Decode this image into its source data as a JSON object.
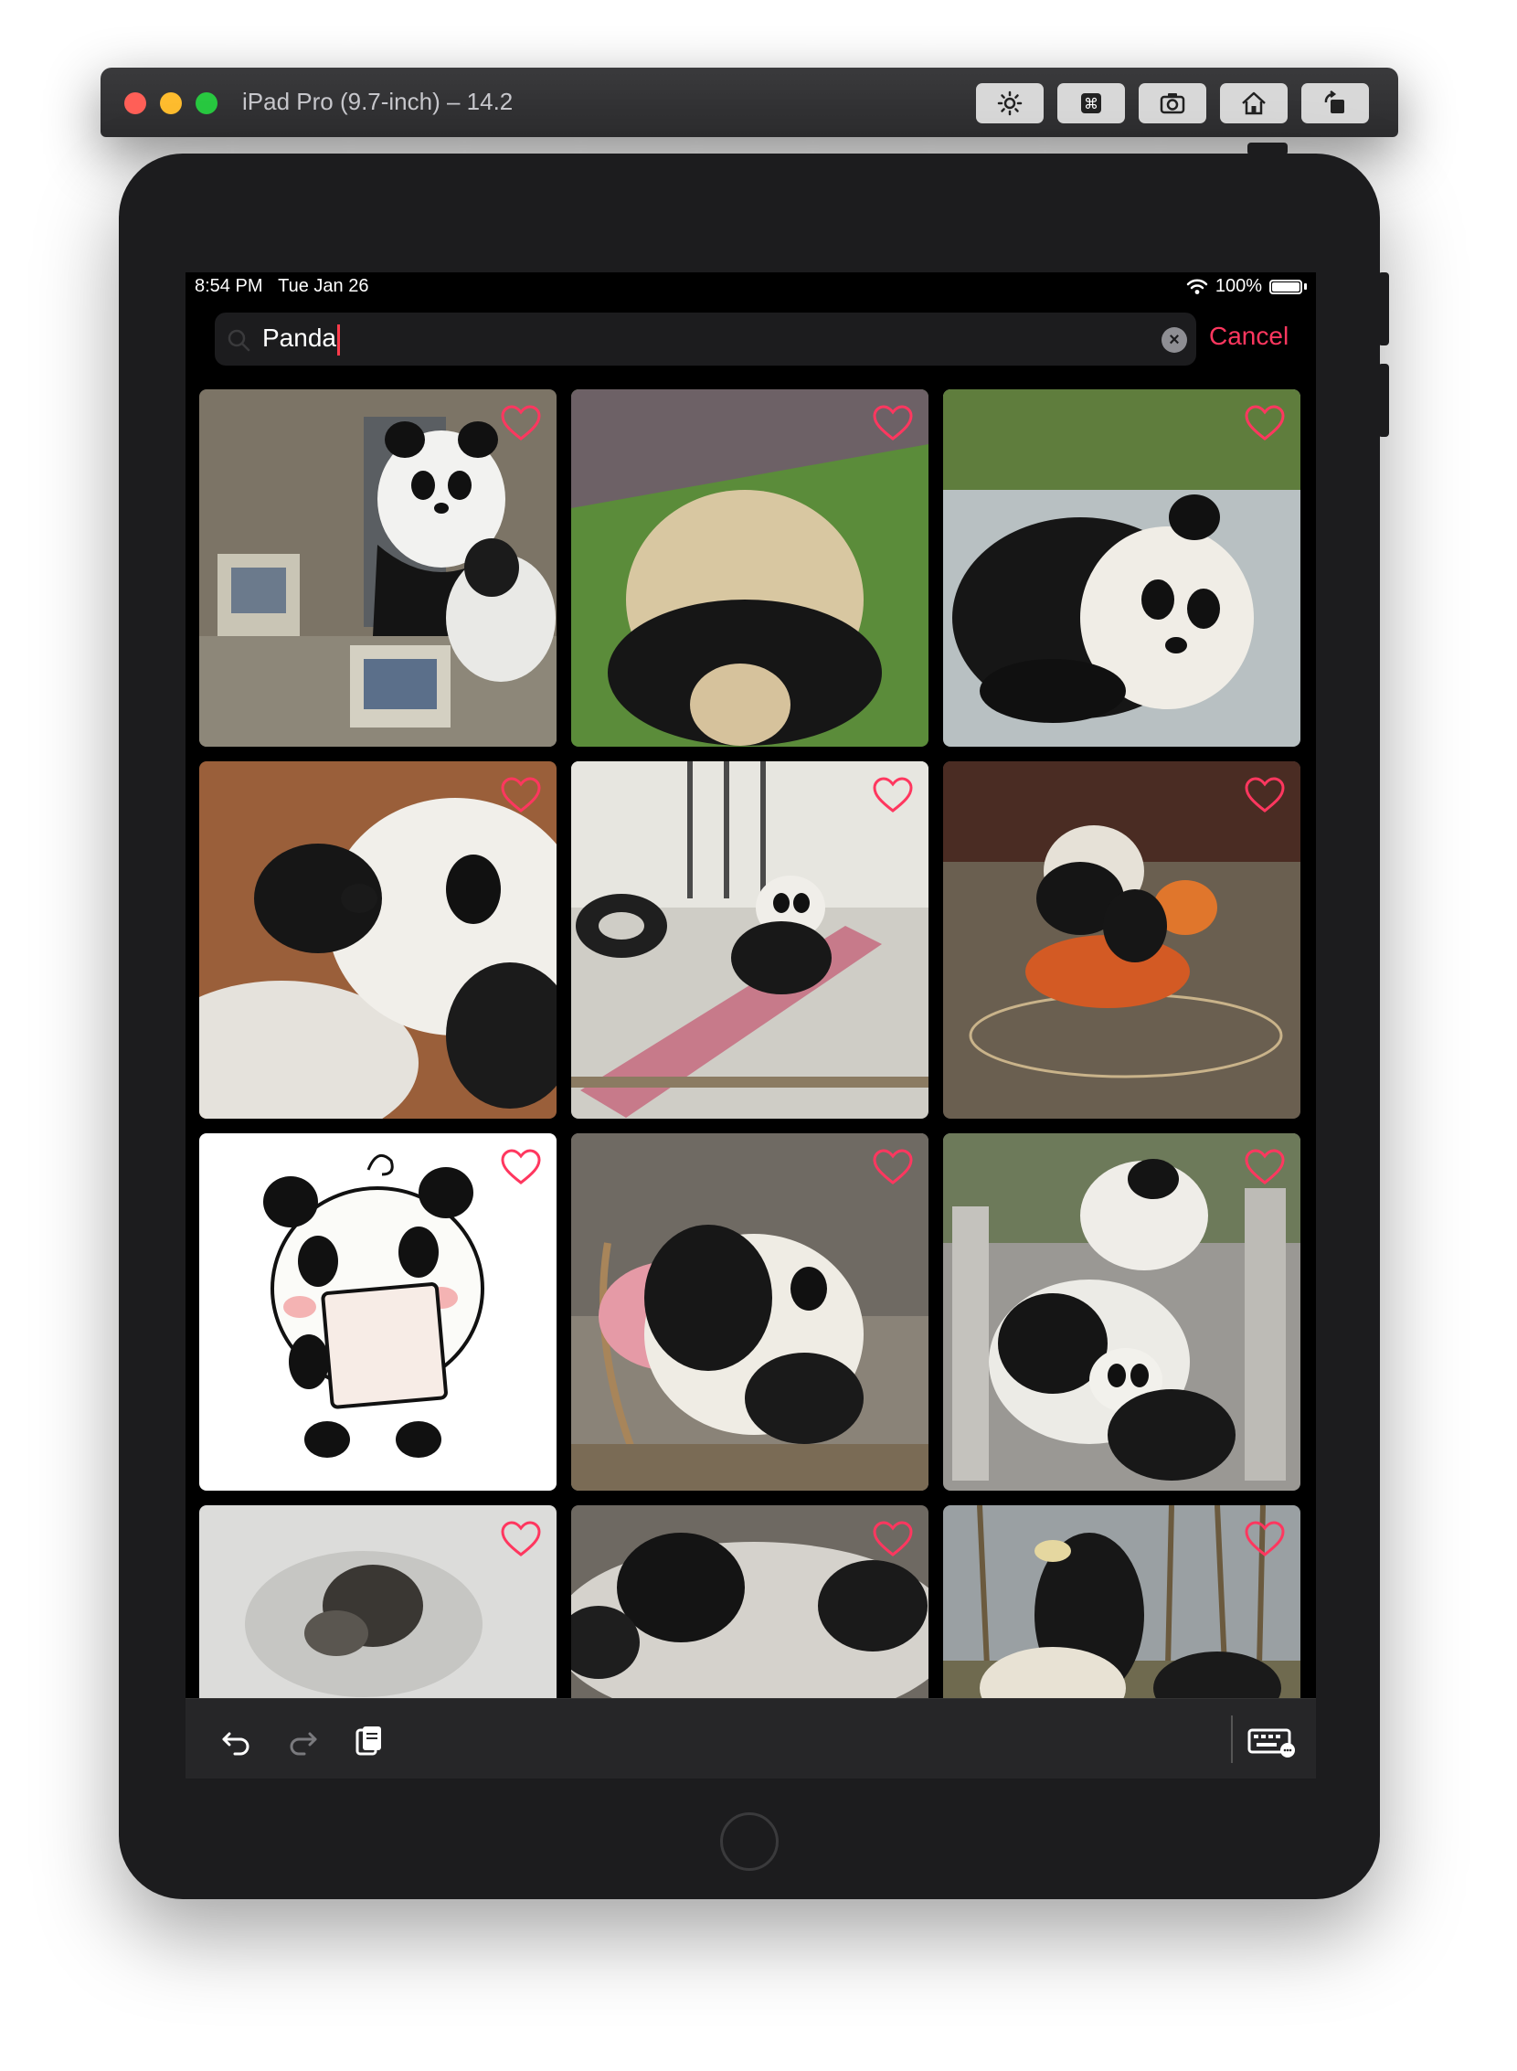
{
  "window": {
    "title": "iPad Pro (9.7-inch) – 14.2"
  },
  "status_bar": {
    "time": "8:54 PM",
    "date": "Tue Jan 26",
    "battery": "100%"
  },
  "search": {
    "value": "Panda",
    "cancel_label": "Cancel"
  },
  "grid": {
    "items": [
      {
        "subject": "panda-in-office"
      },
      {
        "subject": "panda-rolling-on-grass"
      },
      {
        "subject": "panda-on-floor"
      },
      {
        "subject": "baby-panda-closeup"
      },
      {
        "subject": "panda-in-hammock"
      },
      {
        "subject": "panda-on-orange-toy"
      },
      {
        "subject": "cartoon-panda-holding-sign"
      },
      {
        "subject": "panda-on-chair"
      },
      {
        "subject": "pandas-on-stairs"
      },
      {
        "subject": "panda-in-snow"
      },
      {
        "subject": "panda-sleeping"
      },
      {
        "subject": "panda-eating-bamboo"
      }
    ]
  },
  "colors": {
    "accent": "#ff375f",
    "background": "#000000",
    "search_field": "#1c1c1e"
  },
  "icons": {
    "search": "magnifying-glass",
    "clear": "x-circle",
    "favorite": "heart-outline",
    "undo": "undo-arrow",
    "redo": "redo-arrow",
    "paste": "clipboard",
    "keyboard": "keyboard-hide"
  }
}
